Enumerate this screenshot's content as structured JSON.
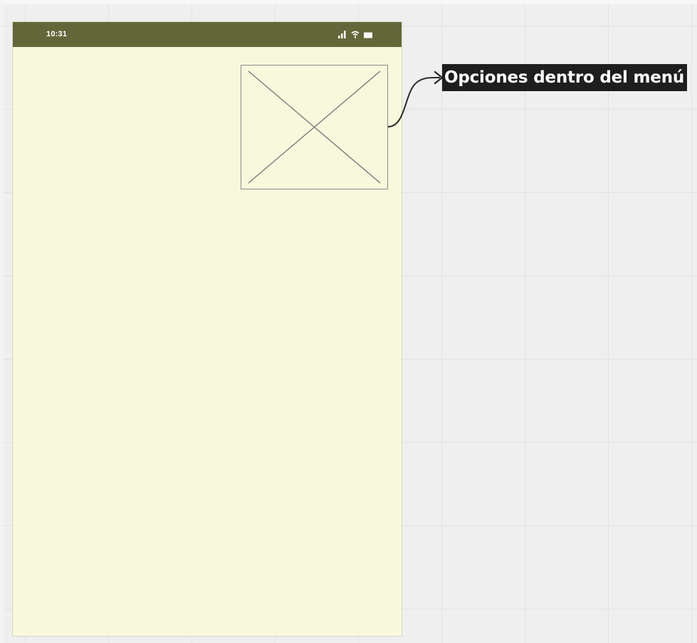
{
  "status_bar": {
    "time": "10:31",
    "icons": [
      "signal-icon",
      "wifi-icon",
      "battery-icon"
    ],
    "color": "#636639"
  },
  "screen": {
    "background": "#f8f8dd"
  },
  "image_placeholder": {
    "icon": "image-placeholder-x-icon"
  },
  "annotation": {
    "label": "Opciones dentro del menú",
    "background": "#1e1e1e",
    "text_color": "#ffffff"
  },
  "canvas": {
    "background": "#efefef",
    "grid_color": "#e2e2e2"
  }
}
